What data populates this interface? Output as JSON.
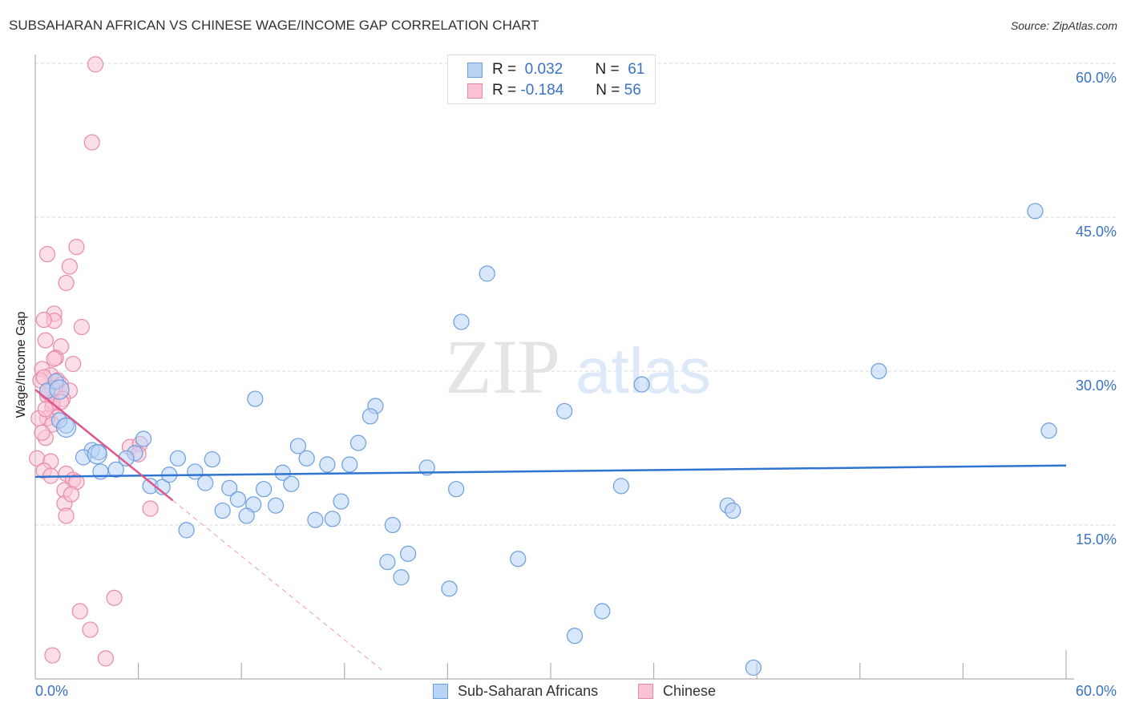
{
  "header": {
    "title": "SUBSAHARAN AFRICAN VS CHINESE WAGE/INCOME GAP CORRELATION CHART",
    "source": "Source: ZipAtlas.com"
  },
  "watermark": {
    "zip": "ZIP",
    "atlas": "atlas"
  },
  "legend": {
    "rows": [
      {
        "r_label": "R =",
        "r_value": "0.032",
        "n_label": "N =",
        "n_value": "61"
      },
      {
        "r_label": "R =",
        "r_value": "-0.184",
        "n_label": "N =",
        "n_value": "56"
      }
    ]
  },
  "colors": {
    "blue_fill": "#b9d3f5",
    "blue_stroke": "#6a9ee0",
    "blue_line": "#2f74d0",
    "pink_fill": "#f9c3d5",
    "pink_stroke": "#e889a8",
    "pink_line": "#e0558a",
    "grid": "#d8d8d8",
    "axis_text": "#3a72c4"
  },
  "chart_data": {
    "type": "scatter",
    "title": "SUBSAHARAN AFRICAN VS CHINESE WAGE/INCOME GAP CORRELATION CHART",
    "xlabel": "",
    "ylabel": "Wage/Income Gap",
    "xlim": [
      0,
      60
    ],
    "ylim": [
      0,
      60
    ],
    "x_tick_labels": [
      "0.0%",
      "60.0%"
    ],
    "y_ticks": [
      15,
      30,
      45,
      60
    ],
    "y_tick_labels": [
      "15.0%",
      "30.0%",
      "45.0%",
      "60.0%"
    ],
    "grid": true,
    "legend_placement": "bottom-center",
    "series": [
      {
        "name": "Sub-Saharan Africans",
        "r": 0.032,
        "n": 61,
        "trend": {
          "x0": 0,
          "y0": 19.7,
          "x1": 60,
          "y1": 20.8
        },
        "points": [
          [
            58.2,
            45.6
          ],
          [
            59.0,
            24.2
          ],
          [
            49.1,
            30.0
          ],
          [
            26.3,
            39.5
          ],
          [
            24.8,
            34.8
          ],
          [
            35.3,
            28.7
          ],
          [
            30.8,
            26.1
          ],
          [
            19.8,
            26.6
          ],
          [
            19.5,
            25.6
          ],
          [
            12.8,
            27.3
          ],
          [
            18.8,
            23.0
          ],
          [
            15.3,
            22.7
          ],
          [
            15.8,
            21.5
          ],
          [
            17.0,
            20.9
          ],
          [
            18.3,
            20.9
          ],
          [
            22.8,
            20.6
          ],
          [
            14.4,
            20.1
          ],
          [
            14.9,
            19.0
          ],
          [
            24.5,
            18.5
          ],
          [
            34.1,
            18.8
          ],
          [
            10.3,
            21.4
          ],
          [
            8.3,
            21.5
          ],
          [
            9.3,
            20.2
          ],
          [
            9.9,
            19.1
          ],
          [
            11.3,
            18.6
          ],
          [
            11.8,
            17.5
          ],
          [
            10.9,
            16.4
          ],
          [
            13.3,
            18.5
          ],
          [
            12.7,
            17.0
          ],
          [
            14.0,
            16.9
          ],
          [
            12.3,
            15.9
          ],
          [
            17.8,
            17.3
          ],
          [
            16.3,
            15.5
          ],
          [
            17.3,
            15.6
          ],
          [
            20.8,
            15.0
          ],
          [
            20.5,
            11.4
          ],
          [
            21.7,
            12.2
          ],
          [
            21.3,
            9.9
          ],
          [
            24.1,
            8.8
          ],
          [
            28.1,
            11.7
          ],
          [
            33.0,
            6.6
          ],
          [
            31.4,
            4.2
          ],
          [
            40.3,
            16.9
          ],
          [
            40.6,
            16.4
          ],
          [
            41.8,
            1.1
          ],
          [
            6.3,
            23.4
          ],
          [
            5.8,
            22.0
          ],
          [
            5.3,
            21.5
          ],
          [
            4.7,
            20.4
          ],
          [
            3.8,
            20.2
          ],
          [
            6.7,
            18.8
          ],
          [
            7.4,
            18.7
          ],
          [
            7.8,
            19.9
          ],
          [
            8.8,
            14.5
          ],
          [
            3.3,
            22.3
          ],
          [
            2.8,
            21.6
          ],
          [
            3.7,
            22.1
          ],
          [
            1.8,
            24.7
          ],
          [
            1.4,
            25.2
          ],
          [
            0.7,
            28.1
          ],
          [
            1.2,
            29.0
          ]
        ]
      },
      {
        "name": "Chinese",
        "r": -0.184,
        "n": 56,
        "trend": {
          "x0": 0,
          "y0": 28.2,
          "x1": 8.0,
          "y1": 17.4,
          "dashed_to_x": 20.3,
          "dashed_to_y": 0.7
        },
        "points": [
          [
            3.5,
            59.9
          ],
          [
            3.3,
            52.3
          ],
          [
            2.4,
            42.1
          ],
          [
            0.7,
            41.4
          ],
          [
            2.0,
            40.2
          ],
          [
            1.8,
            38.6
          ],
          [
            1.1,
            35.6
          ],
          [
            1.1,
            34.9
          ],
          [
            0.5,
            35.0
          ],
          [
            2.7,
            34.3
          ],
          [
            0.6,
            33.0
          ],
          [
            1.5,
            32.4
          ],
          [
            1.2,
            31.3
          ],
          [
            1.1,
            31.2
          ],
          [
            2.2,
            30.7
          ],
          [
            0.4,
            30.2
          ],
          [
            0.9,
            29.6
          ],
          [
            0.3,
            29.1
          ],
          [
            1.3,
            29.1
          ],
          [
            1.5,
            28.7
          ],
          [
            1.0,
            28.3
          ],
          [
            2.0,
            28.1
          ],
          [
            0.7,
            27.6
          ],
          [
            1.6,
            27.3
          ],
          [
            1.0,
            26.5
          ],
          [
            1.3,
            25.5
          ],
          [
            0.7,
            25.4
          ],
          [
            0.2,
            25.4
          ],
          [
            1.0,
            24.8
          ],
          [
            0.6,
            23.5
          ],
          [
            5.5,
            22.6
          ],
          [
            6.1,
            22.9
          ],
          [
            6.0,
            21.9
          ],
          [
            0.1,
            21.5
          ],
          [
            0.9,
            21.2
          ],
          [
            0.5,
            20.3
          ],
          [
            0.9,
            19.8
          ],
          [
            1.8,
            20.0
          ],
          [
            2.2,
            19.4
          ],
          [
            2.4,
            19.2
          ],
          [
            1.7,
            18.4
          ],
          [
            1.7,
            17.1
          ],
          [
            1.8,
            15.9
          ],
          [
            6.7,
            16.6
          ],
          [
            4.6,
            7.9
          ],
          [
            2.6,
            6.6
          ],
          [
            3.2,
            4.8
          ],
          [
            1.0,
            2.3
          ],
          [
            4.1,
            2.0
          ],
          [
            0.5,
            29.4
          ],
          [
            0.7,
            28.0
          ],
          [
            1.0,
            27.0
          ],
          [
            0.6,
            26.3
          ],
          [
            1.5,
            27.0
          ],
          [
            0.4,
            24.0
          ],
          [
            2.1,
            18.0
          ]
        ]
      }
    ]
  }
}
